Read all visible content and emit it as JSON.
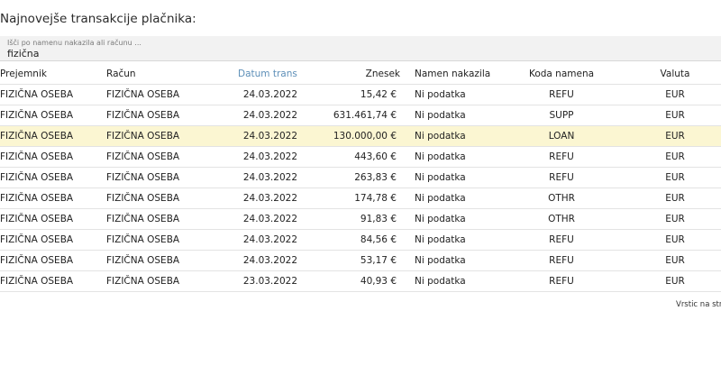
{
  "page": {
    "title": "Najnovejše transakcije plačnika:"
  },
  "search": {
    "label": "Išči po namenu nakazila ali računu ...",
    "value": "fizična"
  },
  "table": {
    "headers": {
      "prejemnik": "Prejemnik",
      "racun": "Račun",
      "datum": "Datum transakcije",
      "znesek": "Znesek",
      "namen": "Namen nakazila",
      "koda": "Koda namena",
      "valuta": "Valuta"
    },
    "sorted_column": "datum",
    "sort_icon": "arrow-down-icon",
    "highlight_color": "#fbf6d2",
    "rows": [
      {
        "prejemnik": "FIZIČNA OSEBA",
        "racun": "FIZIČNA OSEBA",
        "datum": "24.03.2022",
        "znesek": "15,42 €",
        "namen": "Ni podatka",
        "koda": "REFU",
        "valuta": "EUR",
        "highlighted": false
      },
      {
        "prejemnik": "FIZIČNA OSEBA",
        "racun": "FIZIČNA OSEBA",
        "datum": "24.03.2022",
        "znesek": "631.461,74 €",
        "namen": "Ni podatka",
        "koda": "SUPP",
        "valuta": "EUR",
        "highlighted": false
      },
      {
        "prejemnik": "FIZIČNA OSEBA",
        "racun": "FIZIČNA OSEBA",
        "datum": "24.03.2022",
        "znesek": "130.000,00 €",
        "namen": "Ni podatka",
        "koda": "LOAN",
        "valuta": "EUR",
        "highlighted": true
      },
      {
        "prejemnik": "FIZIČNA OSEBA",
        "racun": "FIZIČNA OSEBA",
        "datum": "24.03.2022",
        "znesek": "443,60 €",
        "namen": "Ni podatka",
        "koda": "REFU",
        "valuta": "EUR",
        "highlighted": false
      },
      {
        "prejemnik": "FIZIČNA OSEBA",
        "racun": "FIZIČNA OSEBA",
        "datum": "24.03.2022",
        "znesek": "263,83 €",
        "namen": "Ni podatka",
        "koda": "REFU",
        "valuta": "EUR",
        "highlighted": false
      },
      {
        "prejemnik": "FIZIČNA OSEBA",
        "racun": "FIZIČNA OSEBA",
        "datum": "24.03.2022",
        "znesek": "174,78 €",
        "namen": "Ni podatka",
        "koda": "OTHR",
        "valuta": "EUR",
        "highlighted": false
      },
      {
        "prejemnik": "FIZIČNA OSEBA",
        "racun": "FIZIČNA OSEBA",
        "datum": "24.03.2022",
        "znesek": "91,83 €",
        "namen": "Ni podatka",
        "koda": "OTHR",
        "valuta": "EUR",
        "highlighted": false
      },
      {
        "prejemnik": "FIZIČNA OSEBA",
        "racun": "FIZIČNA OSEBA",
        "datum": "24.03.2022",
        "znesek": "84,56 €",
        "namen": "Ni podatka",
        "koda": "REFU",
        "valuta": "EUR",
        "highlighted": false
      },
      {
        "prejemnik": "FIZIČNA OSEBA",
        "racun": "FIZIČNA OSEBA",
        "datum": "24.03.2022",
        "znesek": "53,17 €",
        "namen": "Ni podatka",
        "koda": "REFU",
        "valuta": "EUR",
        "highlighted": false
      },
      {
        "prejemnik": "FIZIČNA OSEBA",
        "racun": "FIZIČNA OSEBA",
        "datum": "23.03.2022",
        "znesek": "40,93 €",
        "namen": "Ni podatka",
        "koda": "REFU",
        "valuta": "EUR",
        "highlighted": false
      }
    ]
  },
  "footer": {
    "rows_per_page_label": "Vrstic na stra"
  }
}
